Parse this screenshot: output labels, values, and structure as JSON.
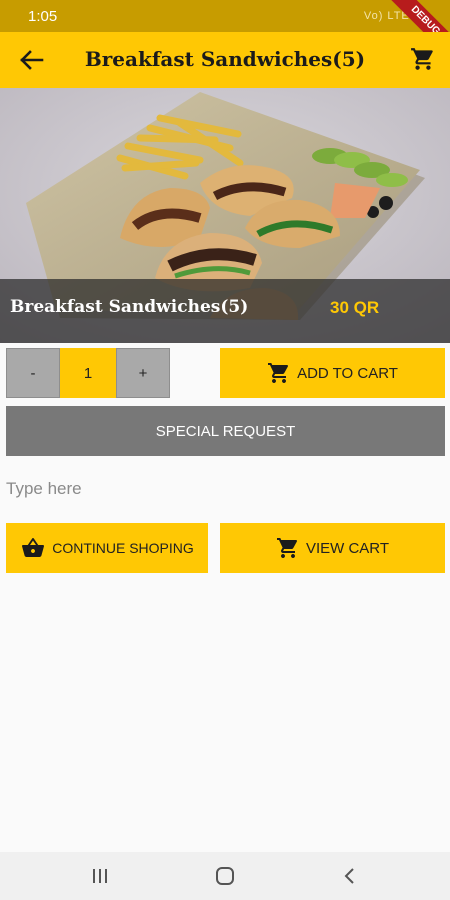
{
  "status_bar": {
    "time": "1:05",
    "indicators": "Vo) LTE1 ▮",
    "debug_label": "DEBUG"
  },
  "app_bar": {
    "title": "Breakfast Sandwiches(5)",
    "back_icon": "arrow-back-icon",
    "cart_icon": "shopping-cart-icon"
  },
  "product": {
    "name": "Breakfast Sandwiches(5)",
    "price": "30 QR",
    "image": "pita-sandwiches-with-fries-photo"
  },
  "quantity": {
    "minus_label": "-",
    "value": "1",
    "plus_label": "+"
  },
  "buttons": {
    "add_to_cart": "ADD TO CART",
    "special_request": "SPECIAL REQUEST",
    "continue_shopping": "CONTINUE SHOPING",
    "view_cart": "VIEW CART"
  },
  "note": {
    "placeholder": "Type here",
    "value": ""
  },
  "colors": {
    "accent": "#ffc804",
    "status_bar": "#c79c00",
    "secondary_button": "#787878",
    "qty_button": "#a9a9a9"
  },
  "nav": {
    "recents_icon": "recents-icon",
    "home_icon": "home-icon",
    "back_icon": "nav-back-icon"
  }
}
